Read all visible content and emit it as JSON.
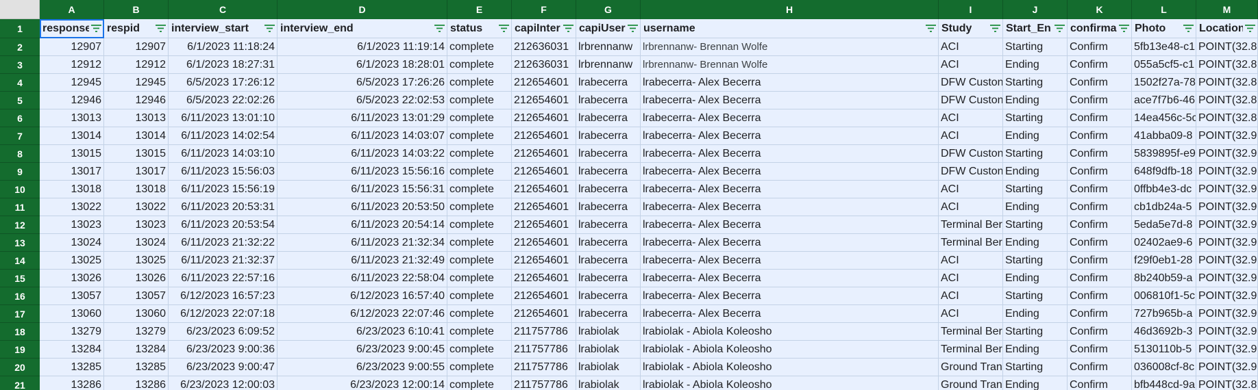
{
  "column_letters": [
    "A",
    "B",
    "C",
    "D",
    "E",
    "F",
    "G",
    "H",
    "I",
    "J",
    "K",
    "L",
    "M"
  ],
  "headers": [
    "response",
    "respid",
    "interview_start",
    "interview_end",
    "status",
    "capiInter",
    "capiUser",
    "username",
    "Study",
    "Start_En",
    "confirma",
    "Photo",
    "Location"
  ],
  "icons": {
    "filter": "filter-icon"
  },
  "colors": {
    "header_green": "#146c2e",
    "cell_fill": "#e8f0fe",
    "grid": "#c3d2e6",
    "selection": "#1a73e8"
  },
  "rows": [
    {
      "n": "2",
      "cells": [
        "12907",
        "12907",
        "6/1/2023 11:18:24",
        "6/1/2023 11:19:14",
        "complete",
        "212636031",
        "lrbrennanw",
        "lrbrennanw- Brennan Wolfe",
        "ACI",
        "Starting",
        "Confirm",
        "5fb13e48-c1",
        "POINT(32.8"
      ]
    },
    {
      "n": "3",
      "cells": [
        "12912",
        "12912",
        "6/1/2023 18:27:31",
        "6/1/2023 18:28:01",
        "complete",
        "212636031",
        "lrbrennanw",
        "lrbrennanw- Brennan Wolfe",
        "ACI",
        "Ending",
        "Confirm",
        "055a5cf5-c1",
        "POINT(32.8"
      ]
    },
    {
      "n": "4",
      "cells": [
        "12945",
        "12945",
        "6/5/2023 17:26:12",
        "6/5/2023 17:26:26",
        "complete",
        "212654601",
        "lrabecerra",
        "lrabecerra- Alex Becerra",
        "DFW Custon",
        "Starting",
        "Confirm",
        "1502f27a-78",
        "POINT(32.8"
      ]
    },
    {
      "n": "5",
      "cells": [
        "12946",
        "12946",
        "6/5/2023 22:02:26",
        "6/5/2023 22:02:53",
        "complete",
        "212654601",
        "lrabecerra",
        "lrabecerra- Alex Becerra",
        "DFW Custon",
        "Ending",
        "Confirm",
        "ace7f7b6-46",
        "POINT(32.8"
      ]
    },
    {
      "n": "6",
      "cells": [
        "13013",
        "13013",
        "6/11/2023 13:01:10",
        "6/11/2023 13:01:29",
        "complete",
        "212654601",
        "lrabecerra",
        "lrabecerra- Alex Becerra",
        "ACI",
        "Starting",
        "Confirm",
        "14ea456c-5c",
        "POINT(32.8"
      ]
    },
    {
      "n": "7",
      "cells": [
        "13014",
        "13014",
        "6/11/2023 14:02:54",
        "6/11/2023 14:03:07",
        "complete",
        "212654601",
        "lrabecerra",
        "lrabecerra- Alex Becerra",
        "ACI",
        "Ending",
        "Confirm",
        "41abba09-8",
        "POINT(32.9"
      ]
    },
    {
      "n": "8",
      "cells": [
        "13015",
        "13015",
        "6/11/2023 14:03:10",
        "6/11/2023 14:03:22",
        "complete",
        "212654601",
        "lrabecerra",
        "lrabecerra- Alex Becerra",
        "DFW Custon",
        "Starting",
        "Confirm",
        "5839895f-e9",
        "POINT(32.9"
      ]
    },
    {
      "n": "9",
      "cells": [
        "13017",
        "13017",
        "6/11/2023 15:56:03",
        "6/11/2023 15:56:16",
        "complete",
        "212654601",
        "lrabecerra",
        "lrabecerra- Alex Becerra",
        "DFW Custon",
        "Ending",
        "Confirm",
        "648f9dfb-18",
        "POINT(32.9"
      ]
    },
    {
      "n": "10",
      "cells": [
        "13018",
        "13018",
        "6/11/2023 15:56:19",
        "6/11/2023 15:56:31",
        "complete",
        "212654601",
        "lrabecerra",
        "lrabecerra- Alex Becerra",
        "ACI",
        "Starting",
        "Confirm",
        "0ffbb4e3-dc",
        "POINT(32.9"
      ]
    },
    {
      "n": "11",
      "cells": [
        "13022",
        "13022",
        "6/11/2023 20:53:31",
        "6/11/2023 20:53:50",
        "complete",
        "212654601",
        "lrabecerra",
        "lrabecerra- Alex Becerra",
        "ACI",
        "Ending",
        "Confirm",
        "cb1db24a-5",
        "POINT(32.9"
      ]
    },
    {
      "n": "12",
      "cells": [
        "13023",
        "13023",
        "6/11/2023 20:53:54",
        "6/11/2023 20:54:14",
        "complete",
        "212654601",
        "lrabecerra",
        "lrabecerra- Alex Becerra",
        "Terminal Ber",
        "Starting",
        "Confirm",
        "5eda5e7d-8",
        "POINT(32.9"
      ]
    },
    {
      "n": "13",
      "cells": [
        "13024",
        "13024",
        "6/11/2023 21:32:22",
        "6/11/2023 21:32:34",
        "complete",
        "212654601",
        "lrabecerra",
        "lrabecerra- Alex Becerra",
        "Terminal Ber",
        "Ending",
        "Confirm",
        "02402ae9-6",
        "POINT(32.9"
      ]
    },
    {
      "n": "14",
      "cells": [
        "13025",
        "13025",
        "6/11/2023 21:32:37",
        "6/11/2023 21:32:49",
        "complete",
        "212654601",
        "lrabecerra",
        "lrabecerra- Alex Becerra",
        "ACI",
        "Starting",
        "Confirm",
        "f29f0eb1-28",
        "POINT(32.9"
      ]
    },
    {
      "n": "15",
      "cells": [
        "13026",
        "13026",
        "6/11/2023 22:57:16",
        "6/11/2023 22:58:04",
        "complete",
        "212654601",
        "lrabecerra",
        "lrabecerra- Alex Becerra",
        "ACI",
        "Ending",
        "Confirm",
        "8b240b59-a",
        "POINT(32.9"
      ]
    },
    {
      "n": "16",
      "cells": [
        "13057",
        "13057",
        "6/12/2023 16:57:23",
        "6/12/2023 16:57:40",
        "complete",
        "212654601",
        "lrabecerra",
        "lrabecerra- Alex Becerra",
        "ACI",
        "Starting",
        "Confirm",
        "006810f1-5c",
        "POINT(32.9"
      ]
    },
    {
      "n": "17",
      "cells": [
        "13060",
        "13060",
        "6/12/2023 22:07:18",
        "6/12/2023 22:07:46",
        "complete",
        "212654601",
        "lrabecerra",
        "lrabecerra- Alex Becerra",
        "ACI",
        "Ending",
        "Confirm",
        "727b965b-a",
        "POINT(32.9"
      ]
    },
    {
      "n": "18",
      "cells": [
        "13279",
        "13279",
        "6/23/2023 6:09:52",
        "6/23/2023 6:10:41",
        "complete",
        "211757786",
        "lrabiolak",
        "lrabiolak - Abiola Koleosho",
        "Terminal Ber",
        "Starting",
        "Confirm",
        "46d3692b-3",
        "POINT(32.9"
      ]
    },
    {
      "n": "19",
      "cells": [
        "13284",
        "13284",
        "6/23/2023 9:00:36",
        "6/23/2023 9:00:45",
        "complete",
        "211757786",
        "lrabiolak",
        "lrabiolak - Abiola Koleosho",
        "Terminal Ber",
        "Ending",
        "Confirm",
        "5130110b-5",
        "POINT(32.9"
      ]
    },
    {
      "n": "20",
      "cells": [
        "13285",
        "13285",
        "6/23/2023 9:00:47",
        "6/23/2023 9:00:55",
        "complete",
        "211757786",
        "lrabiolak",
        "lrabiolak - Abiola Koleosho",
        "Ground Tran",
        "Starting",
        "Confirm",
        "036008cf-8c",
        "POINT(32.9"
      ]
    },
    {
      "n": "21",
      "cells": [
        "13286",
        "13286",
        "6/23/2023 12:00:03",
        "6/23/2023 12:00:14",
        "complete",
        "211757786",
        "lrabiolak",
        "lrabiolak - Abiola Koleosho",
        "Ground Tran",
        "Ending",
        "Confirm",
        "bfb448cd-9a",
        "POINT(32.8"
      ]
    }
  ]
}
